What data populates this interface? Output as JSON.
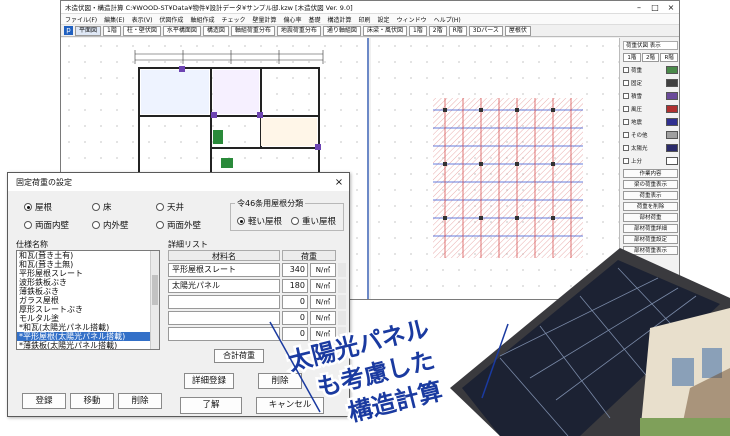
{
  "app": {
    "title": "木造伏図・構造計算 C:¥WOOD-ST¥Data¥物件¥設計データ¥サンプル邸.kzw [木造伏図 Ver. 9.0]",
    "menu": [
      "ファイル(F)",
      "編集(E)",
      "表示(V)",
      "伏図作成",
      "軸組作成",
      "チェック",
      "壁量計算",
      "偏心率",
      "基礎",
      "構造計算",
      "印刷",
      "設定",
      "ウィンドウ",
      "ヘルプ(H)"
    ],
    "toolbar": [
      "平面図",
      "1階",
      "柱・壁伏図",
      "水平構面図",
      "構造図",
      "軸組荷重分布",
      "地震荷重分布",
      "通り軸組図",
      "床梁・風伏図",
      "1階",
      "2階",
      "R階",
      "3Dパース",
      "屋根伏"
    ],
    "right_panel": {
      "header": "荷重伏図 表示",
      "floors": [
        "1階",
        "2階",
        "R階"
      ],
      "layers": [
        {
          "label": "荷重",
          "color": "#4a8a4a"
        },
        {
          "label": "固定",
          "color": "#404040"
        },
        {
          "label": "積雪",
          "color": "#6a4a9a"
        },
        {
          "label": "風圧",
          "color": "#b03030"
        },
        {
          "label": "地震",
          "color": "#303090"
        },
        {
          "label": "その他",
          "color": "#a0a0a0"
        },
        {
          "label": "太陽光",
          "color": "#2a2a6a"
        },
        {
          "label": "上分",
          "color": "#ffffff"
        }
      ],
      "buttons": [
        "作業内容",
        "梁の荷重表示",
        "荷重表示",
        "荷重を削除",
        "部材荷重",
        "部材荷重詳細",
        "部材荷重設定",
        "部材荷重表示"
      ]
    }
  },
  "dialog": {
    "title": "固定荷重の設定",
    "close": "×",
    "category_radios": [
      {
        "label": "屋根",
        "selected": true
      },
      {
        "label": "床",
        "selected": false
      },
      {
        "label": "天井",
        "selected": false
      },
      {
        "label": "両面内壁",
        "selected": false
      },
      {
        "label": "内外壁",
        "selected": false
      },
      {
        "label": "両面外壁",
        "selected": false
      }
    ],
    "roof_group": {
      "legend": "令46条用屋根分類",
      "options": [
        {
          "label": "軽い屋根",
          "selected": true
        },
        {
          "label": "重い屋根",
          "selected": false
        }
      ]
    },
    "spec_list": {
      "legend": "仕様名称",
      "items": [
        "和瓦(葺き土有)",
        "和瓦(葺き土無)",
        "平形屋根スレート",
        "波形鉄板ぶき",
        "薄鉄板ぶき",
        "ガラス屋根",
        "厚形スレートぶき",
        "モルタル塗",
        "*和瓦(太陽光パネル搭載)",
        "*平形屋根(太陽光パネル搭載)",
        "*薄鉄板(太陽光パネル搭載)"
      ],
      "selected_index": 9
    },
    "spec_buttons": [
      "登録",
      "移動",
      "削除"
    ],
    "detail": {
      "legend": "詳細リスト",
      "col_material": "材料名",
      "col_load": "荷重",
      "rows": [
        {
          "name": "平形屋根スレート",
          "value": "340",
          "unit": "N/㎡"
        },
        {
          "name": "太陽光パネル",
          "value": "180",
          "unit": "N/㎡"
        },
        {
          "name": "",
          "value": "0",
          "unit": "N/㎡"
        },
        {
          "name": "",
          "value": "0",
          "unit": "N/㎡"
        },
        {
          "name": "",
          "value": "0",
          "unit": "N/㎡"
        }
      ],
      "total_label": "合計荷重",
      "register_button": "詳細登録",
      "delete_button": "削除"
    },
    "ok_button": "了解",
    "cancel_button": "キャンセル"
  },
  "caption": {
    "lines": [
      "太陽光パネル",
      "も考慮した",
      "構造計算"
    ],
    "color": "#1a3aa0"
  },
  "colors": {
    "grid_red": "#d23a3a",
    "grid_blue": "#3050d0",
    "selection": "#3370c8"
  }
}
